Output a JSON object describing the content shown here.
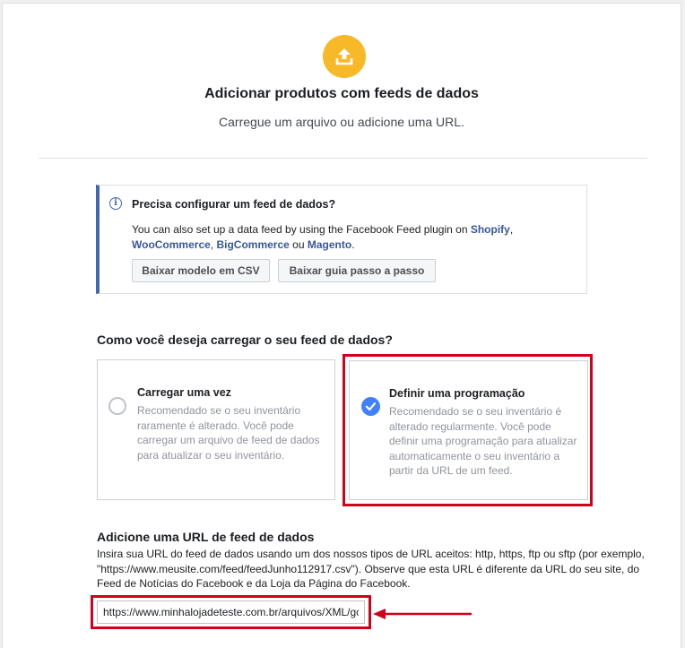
{
  "header": {
    "icon": "upload-icon",
    "title": "Adicionar produtos com feeds de dados",
    "subtitle": "Carregue um arquivo ou adicione uma URL."
  },
  "info": {
    "icon": "info-icon",
    "title": "Precisa configurar um feed de dados?",
    "text_prefix": "You can also set up a data feed by using the Facebook Feed plugin on ",
    "link_shopify": "Shopify",
    "sep1": ", ",
    "link_woocommerce": "WooCommerce",
    "sep2": ", ",
    "link_bigcommerce": "BigCommerce",
    "sep3": " ou ",
    "link_magento": "Magento",
    "text_suffix": ".",
    "button_csv": "Baixar modelo em CSV",
    "button_guide": "Baixar guia passo a passo"
  },
  "upload_method": {
    "question": "Como você deseja carregar o seu feed de dados?",
    "options": [
      {
        "title": "Carregar uma vez",
        "description": "Recomendado se o seu inventário raramente é alterado. Você pode carregar um arquivo de feed de dados para atualizar o seu inventário.",
        "selected": false
      },
      {
        "title": "Definir uma programação",
        "description": "Recomendado se o seu inventário é alterado regularmente. Você pode definir uma programação para atualizar automaticamente o seu inventário a partir da URL de um feed.",
        "selected": true
      }
    ]
  },
  "feed_url": {
    "title": "Adicione uma URL de feed de dados",
    "description": "Insira sua URL do feed de dados usando um dos nossos tipos de URL aceitos: http, https, ftp ou sftp (por exemplo, \"https://www.meusite.com/feed/feedJunho112917.csv\"). Observe que esta URL é diferente da URL do seu site, do Feed de Notícias do Facebook e da Loja da Página do Facebook.",
    "value": "https://www.minhalojadeteste.com.br/arquivos/XML/gc"
  },
  "colors": {
    "accent_yellow": "#f7b928",
    "link_blue": "#385898",
    "checked_blue": "#4080ff",
    "highlight_red": "#d0021b"
  }
}
